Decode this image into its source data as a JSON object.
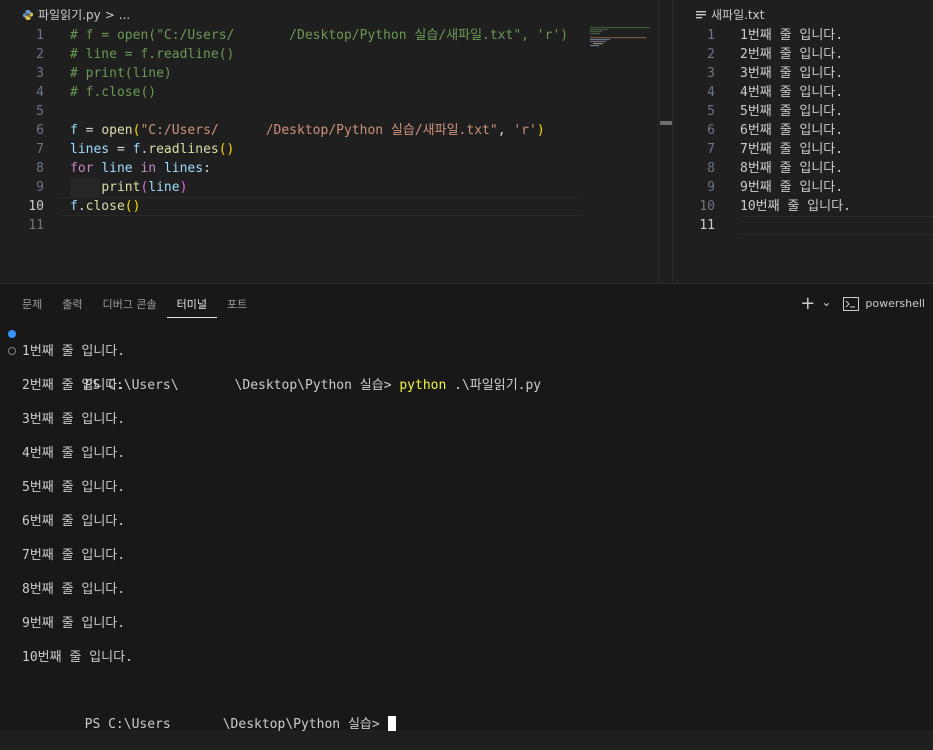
{
  "left_editor": {
    "tab": "파일읽기.py",
    "breadcrumb_sep": ">",
    "breadcrumb_more": "...",
    "lines": [
      {
        "n": "1",
        "segments": [
          [
            "c-com",
            "# f = open(\"C:/Users/"
          ],
          [
            "redact",
            "       "
          ],
          [
            "c-com",
            "/Desktop/Python 실습/새파일.txt\", 'r')"
          ]
        ]
      },
      {
        "n": "2",
        "segments": [
          [
            "c-com",
            "# line = f.readline()"
          ]
        ]
      },
      {
        "n": "3",
        "segments": [
          [
            "c-com",
            "# print(line)"
          ]
        ]
      },
      {
        "n": "4",
        "segments": [
          [
            "c-com",
            "# f.close()"
          ]
        ]
      },
      {
        "n": "5",
        "segments": []
      },
      {
        "n": "6",
        "segments": [
          [
            "c-var",
            "f"
          ],
          [
            "c-plain",
            " = "
          ],
          [
            "c-fn",
            "open"
          ],
          [
            "c-br",
            "("
          ],
          [
            "c-str",
            "\"C:/Users/"
          ],
          [
            "redact",
            "      "
          ],
          [
            "c-str",
            "/Desktop/Python 실습/새파일.txt\""
          ],
          [
            "c-plain",
            ", "
          ],
          [
            "c-str",
            "'r'"
          ],
          [
            "c-br",
            ")"
          ]
        ]
      },
      {
        "n": "7",
        "segments": [
          [
            "c-var",
            "lines"
          ],
          [
            "c-plain",
            " = "
          ],
          [
            "c-var",
            "f"
          ],
          [
            "c-plain",
            "."
          ],
          [
            "c-fn",
            "readlines"
          ],
          [
            "c-br",
            "()"
          ]
        ]
      },
      {
        "n": "8",
        "segments": [
          [
            "c-kw",
            "for"
          ],
          [
            "c-plain",
            " "
          ],
          [
            "c-var",
            "line"
          ],
          [
            "c-plain",
            " "
          ],
          [
            "c-kw",
            "in"
          ],
          [
            "c-plain",
            " "
          ],
          [
            "c-var",
            "lines"
          ],
          [
            "c-plain",
            ":"
          ]
        ]
      },
      {
        "n": "9",
        "segments": [
          [
            "c-plain",
            "    "
          ],
          [
            "c-fn",
            "print"
          ],
          [
            "c-br2",
            "("
          ],
          [
            "c-var",
            "line"
          ],
          [
            "c-br2",
            ")"
          ]
        ]
      },
      {
        "n": "10",
        "segments": [
          [
            "c-var",
            "f"
          ],
          [
            "c-plain",
            "."
          ],
          [
            "c-fn",
            "close"
          ],
          [
            "c-br",
            "()"
          ]
        ]
      },
      {
        "n": "11",
        "segments": []
      }
    ],
    "active_line": "10"
  },
  "right_editor": {
    "tab": "새파일.txt",
    "lines": [
      {
        "n": "1",
        "text": "1번째 줄 입니다."
      },
      {
        "n": "2",
        "text": "2번째 줄 입니다."
      },
      {
        "n": "3",
        "text": "3번째 줄 입니다."
      },
      {
        "n": "4",
        "text": "4번째 줄 입니다."
      },
      {
        "n": "5",
        "text": "5번째 줄 입니다."
      },
      {
        "n": "6",
        "text": "6번째 줄 입니다."
      },
      {
        "n": "7",
        "text": "7번째 줄 입니다."
      },
      {
        "n": "8",
        "text": "8번째 줄 입니다."
      },
      {
        "n": "9",
        "text": "9번째 줄 입니다."
      },
      {
        "n": "10",
        "text": "10번째 줄 입니다."
      },
      {
        "n": "11",
        "text": ""
      }
    ],
    "active_line": "11"
  },
  "panel": {
    "tabs": [
      "문제",
      "출력",
      "디버그 콘솔",
      "터미널",
      "포트"
    ],
    "active_tab": "터미널",
    "add_icon": "+",
    "dropdown_icon": "⌄",
    "shell_name": "powershell"
  },
  "terminal": {
    "prompt1_prefix": "PS C:\\Users\\",
    "prompt1_suffix": "\\Desktop\\Python 실습> ",
    "command_exe": "python",
    "command_arg": " .\\파일읽기.py",
    "output": [
      "1번째 줄 입니다.",
      "2번째 줄 입니다.",
      "3번째 줄 입니다.",
      "4번째 줄 입니다.",
      "5번째 줄 입니다.",
      "6번째 줄 입니다.",
      "7번째 줄 입니다.",
      "8번째 줄 입니다.",
      "9번째 줄 입니다.",
      "10번째 줄 입니다."
    ],
    "prompt2_prefix": "PS C:\\Users",
    "prompt2_suffix": "\\Desktop\\Python 실습> "
  },
  "colors": {
    "editor_bg": "#1f1f1f",
    "panel_bg": "#181818",
    "comment": "#6a9955",
    "string": "#ce9178",
    "keyword": "#c586c0",
    "variable": "#9cdcfe",
    "function": "#dcdcaa",
    "bracket": "#ffd700",
    "python_cmd": "#f5f543",
    "decoration_blue": "#3794ff"
  }
}
